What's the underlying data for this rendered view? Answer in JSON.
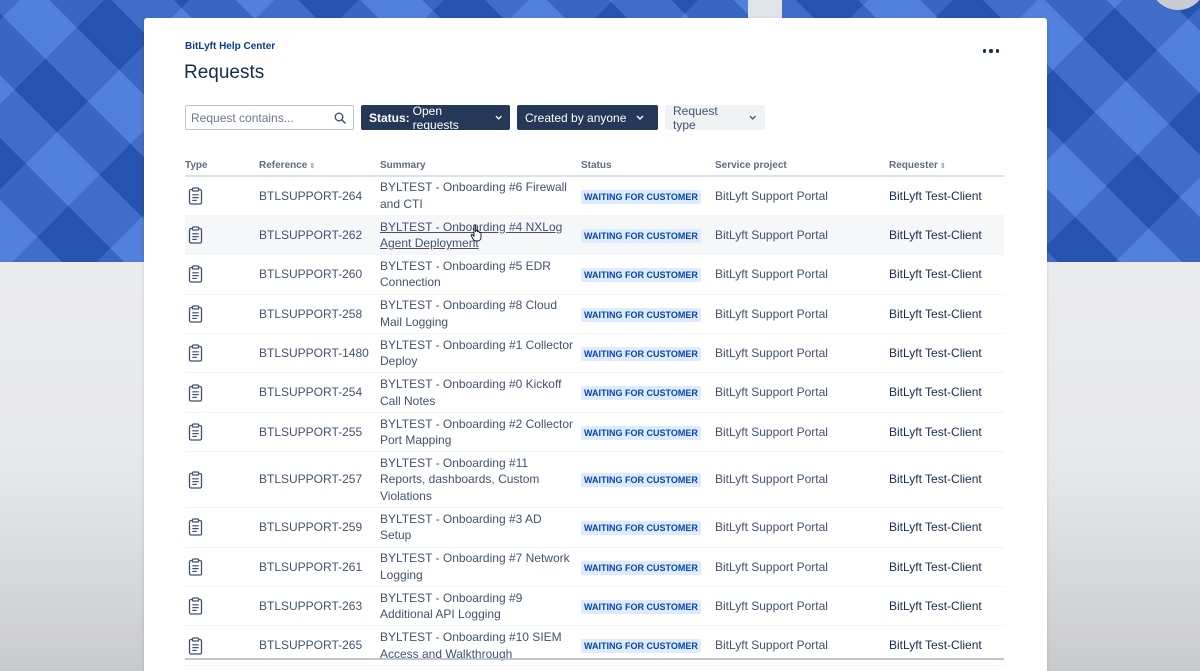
{
  "header": {
    "breadcrumb": "BitLyft Help Center",
    "title": "Requests",
    "more_icon": "more-horizontal-icon"
  },
  "search": {
    "placeholder": "Request contains...",
    "value": "",
    "icon": "search-icon"
  },
  "filters": {
    "status_prefix": "Status:",
    "status_value": "Open requests",
    "created_by": "Created by anyone",
    "request_type": "Request type"
  },
  "table": {
    "columns": [
      "Type",
      "Reference",
      "Summary",
      "Status",
      "Service project",
      "Requester"
    ],
    "rows": [
      {
        "type_icon": "clipboard-icon",
        "reference": "BTLSUPPORT-264",
        "summary": "BYLTEST - Onboarding #6 Firewall and CTI",
        "status": "WAITING FOR CUSTOMER",
        "project": "BitLyft Support Portal",
        "requester": "BitLyft Test-Client"
      },
      {
        "type_icon": "clipboard-icon",
        "reference": "BTLSUPPORT-262",
        "summary": "BYLTEST - Onboarding #4 NXLog Agent Deployment",
        "status": "WAITING FOR CUSTOMER",
        "project": "BitLyft Support Portal",
        "requester": "BitLyft Test-Client"
      },
      {
        "type_icon": "clipboard-icon",
        "reference": "BTLSUPPORT-260",
        "summary": "BYLTEST - Onboarding #5 EDR Connection",
        "status": "WAITING FOR CUSTOMER",
        "project": "BitLyft Support Portal",
        "requester": "BitLyft Test-Client"
      },
      {
        "type_icon": "clipboard-icon",
        "reference": "BTLSUPPORT-258",
        "summary": "BYLTEST - Onboarding #8 Cloud Mail Logging",
        "status": "WAITING FOR CUSTOMER",
        "project": "BitLyft Support Portal",
        "requester": "BitLyft Test-Client"
      },
      {
        "type_icon": "clipboard-icon",
        "reference": "BTLSUPPORT-1480",
        "summary": "BYLTEST - Onboarding #1 Collector Deploy",
        "status": "WAITING FOR CUSTOMER",
        "project": "BitLyft Support Portal",
        "requester": "BitLyft Test-Client"
      },
      {
        "type_icon": "clipboard-icon",
        "reference": "BTLSUPPORT-254",
        "summary": "BYLTEST - Onboarding #0 Kickoff Call Notes",
        "status": "WAITING FOR CUSTOMER",
        "project": "BitLyft Support Portal",
        "requester": "BitLyft Test-Client"
      },
      {
        "type_icon": "clipboard-icon",
        "reference": "BTLSUPPORT-255",
        "summary": "BYLTEST - Onboarding #2 Collector Port Mapping",
        "status": "WAITING FOR CUSTOMER",
        "project": "BitLyft Support Portal",
        "requester": "BitLyft Test-Client"
      },
      {
        "type_icon": "clipboard-icon",
        "reference": "BTLSUPPORT-257",
        "summary": "BYLTEST - Onboarding #11 Reports, dashboards, Custom Violations",
        "status": "WAITING FOR CUSTOMER",
        "project": "BitLyft Support Portal",
        "requester": "BitLyft Test-Client"
      },
      {
        "type_icon": "clipboard-icon",
        "reference": "BTLSUPPORT-259",
        "summary": "BYLTEST - Onboarding #3 AD Setup",
        "status": "WAITING FOR CUSTOMER",
        "project": "BitLyft Support Portal",
        "requester": "BitLyft Test-Client"
      },
      {
        "type_icon": "clipboard-icon",
        "reference": "BTLSUPPORT-261",
        "summary": "BYLTEST - Onboarding #7 Network Logging",
        "status": "WAITING FOR CUSTOMER",
        "project": "BitLyft Support Portal",
        "requester": "BitLyft Test-Client"
      },
      {
        "type_icon": "clipboard-icon",
        "reference": "BTLSUPPORT-263",
        "summary": "BYLTEST - Onboarding #9 Additional API Logging",
        "status": "WAITING FOR CUSTOMER",
        "project": "BitLyft Support Portal",
        "requester": "BitLyft Test-Client"
      },
      {
        "type_icon": "clipboard-icon",
        "reference": "BTLSUPPORT-265",
        "summary": "BYLTEST - Onboarding #10 SIEM Access and Walkthrough",
        "status": "WAITING FOR CUSTOMER",
        "project": "BitLyft Support Portal",
        "requester": "BitLyft Test-Client"
      }
    ]
  },
  "colors": {
    "hero_blue": "#2f66d6",
    "dark_filter": "#253858",
    "lozenge_bg": "#deebff",
    "lozenge_text": "#0747a6",
    "link": "#0c3d91"
  }
}
